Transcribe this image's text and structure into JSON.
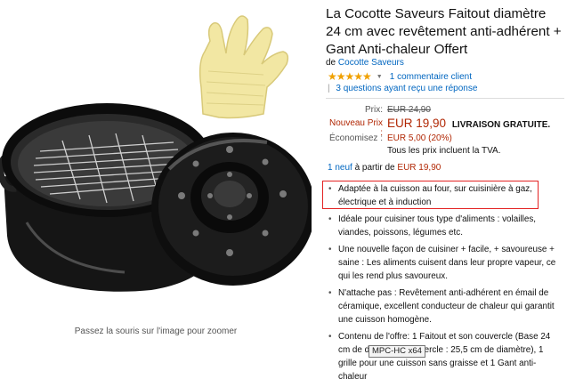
{
  "product": {
    "title": "La Cocotte Saveurs Faitout diamètre 24 cm avec revêtement anti-adhérent + Gant Anti-chaleur Offert",
    "brand_prefix": "de",
    "brand_name": "Cocotte Saveurs",
    "rating_stars": 5,
    "reviews_link": "1 commentaire client",
    "qa_link": "3 questions ayant reçu une réponse"
  },
  "pricing": {
    "prix_label": "Prix:",
    "prix_value": "EUR 24,90",
    "nouveau_label": "Nouveau Prix :",
    "nouveau_value": "EUR 19,90",
    "free_delivery": "LIVRAISON GRATUITE.",
    "economisez_label": "Économisez :",
    "economisez_value": "EUR 5,00 (20%)",
    "tva_note": "Tous les prix incluent la TVA."
  },
  "offers": {
    "neuf_link": "1 neuf",
    "from_text": "à partir de",
    "from_price": "EUR 19,90"
  },
  "features": [
    "Adaptée à la cuisson au four, sur cuisinière à gaz, électrique et à induction",
    "Idéale pour cuisiner tous type d'aliments : volailles, viandes, poissons, légumes etc.",
    "Une nouvelle façon de cuisiner + facile, + savoureuse + saine : Les aliments cuisent dans leur propre vapeur, ce qui les rend plus savoureux.",
    "N'attache pas : Revêtement anti-adhérent en émail de céramique, excellent conducteur de chaleur qui garantit une cuisson homogène.",
    "Contenu de l'offre: 1 Faitout et son couvercle (Base 24 cm de diamètre, Couvercle : 25,5 cm de diamètre), 1 grille pour une cuisson sans graisse et 1 Gant anti-chaleur"
  ],
  "image": {
    "zoom_hint": "Passez la souris sur l'image pour zoomer"
  },
  "overlay": {
    "tooltip": "MPC-HC x64"
  },
  "colors": {
    "link": "#0066c0",
    "price_red": "#b12704",
    "star": "#f0a100",
    "highlight_border": "#e32222"
  }
}
